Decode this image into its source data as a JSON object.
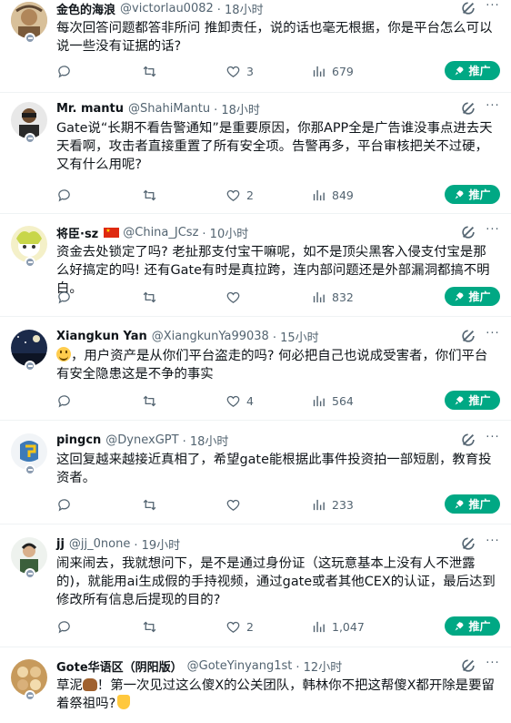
{
  "replies": [
    {
      "name": "金色的海浪",
      "handle": "@victorlau0082",
      "time": "· 18小时",
      "text": "每次回答问题都答非所问 推卸责任，说的话也毫无根据，你是平台怎么可以说一些没有证据的话?",
      "replies": "",
      "retweets": "",
      "likes": "3",
      "views": "679"
    },
    {
      "name": "Mr. mantu",
      "handle": "@ShahiMantu",
      "time": "· 18小时",
      "text": "Gate说“长期不看告警通知”是重要原因，你那APP全是广告谁没事点进去天天看啊，攻击者直接重置了所有安全项。告警再多，平台审核把关不过硬，又有什么用呢?",
      "replies": "",
      "retweets": "",
      "likes": "2",
      "views": "849"
    },
    {
      "name": "将臣·sz",
      "handle": "@China_JCsz",
      "time": "· 10小时",
      "text": "资金去处锁定了吗? 老扯那支付宝干嘛呢，如不是顶尖黑客入侵支付宝是那么好搞定的吗! 还有Gate有时是真拉跨，连内部问题还是外部漏洞都搞不明白。",
      "replies": "",
      "retweets": "",
      "likes": "",
      "views": "832"
    },
    {
      "name": "Xiangkun Yan",
      "handle": "@XiangkunYa99038",
      "time": "· 15小时",
      "text": "，用户资产是从你们平台盗走的吗? 何必把自己也说成受害者，你们平台有安全隐患这是不争的事实",
      "replies": "",
      "retweets": "",
      "likes": "4",
      "views": "564"
    },
    {
      "name": "pingcn",
      "handle": "@DynexGPT",
      "time": "· 18小时",
      "text": "这回复越来越接近真相了，希望gate能根据此事件投资拍一部短剧，教育投资者。",
      "replies": "",
      "retweets": "",
      "likes": "",
      "views": "233"
    },
    {
      "name": "jj",
      "handle": "@jj_0none",
      "time": "· 19小时",
      "text": "闹来闹去，我就想问下，是不是通过身份证（这玩意基本上没有人不泄露的)，就能用ai生成假的手持视频，通过gate或者其他CEX的认证，最后达到修改所有信息后提现的目的?",
      "replies": "",
      "retweets": "",
      "likes": "2",
      "views": "1,047"
    },
    {
      "name": "Gote华语区（阴阳版）",
      "handle": "@GoteYinyang1st",
      "time": "· 12小时",
      "text_a": "草泥",
      "text_b": "！第一次见过这么傻X的公关团队，韩林你不把这帮傻X都开除是要留着祭祖吗?"
    }
  ],
  "promote_label": "推广",
  "more_label": "···",
  "colors": {
    "promote": "#00a884",
    "meta": "#536471",
    "text": "#0f1419"
  },
  "icons": [
    "reply-icon",
    "retweet-icon",
    "like-icon",
    "views-icon",
    "bookmark-icon",
    "grok-icon",
    "rocket-icon",
    "more-icon"
  ]
}
